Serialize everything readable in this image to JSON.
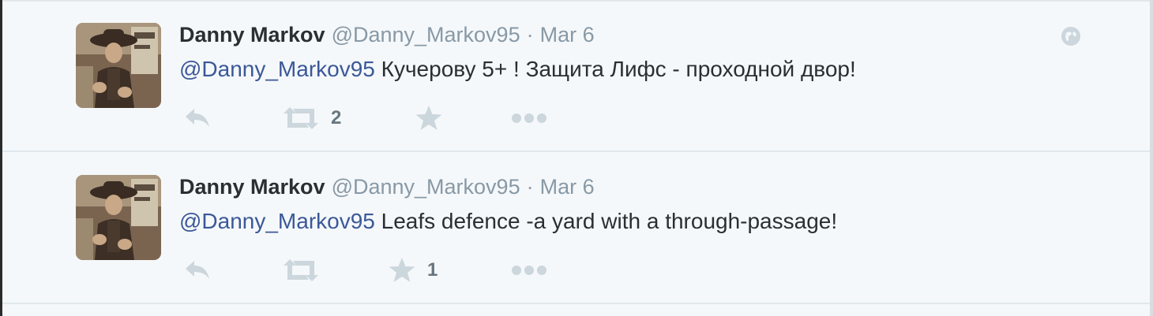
{
  "tweets": [
    {
      "name": "Danny Markov",
      "handle": "@Danny_Markov95",
      "separator": "·",
      "date": "Mar 6",
      "mention": "@Danny_Markov95",
      "body": " Кучерову  5+ ! Защита Лифс - проходной двор!",
      "retweet_count": "2",
      "favorite_count": "",
      "icons": [
        "reply-icon",
        "retweet-icon",
        "favorite-icon",
        "more-icon",
        "globe-icon"
      ]
    },
    {
      "name": "Danny Markov",
      "handle": "@Danny_Markov95",
      "separator": "·",
      "date": "Mar 6",
      "mention": "@Danny_Markov95",
      "body": " Leafs defence -a yard with a through-passage!",
      "retweet_count": "",
      "favorite_count": "1",
      "icons": [
        "reply-icon",
        "retweet-icon",
        "favorite-icon",
        "more-icon"
      ]
    }
  ],
  "colors": {
    "background": "#f5f8fa",
    "name": "#292f33",
    "muted": "#8899a6",
    "mention": "#3b5898",
    "action_icon": "#ccd6dd",
    "divider": "#e1e8ed"
  }
}
